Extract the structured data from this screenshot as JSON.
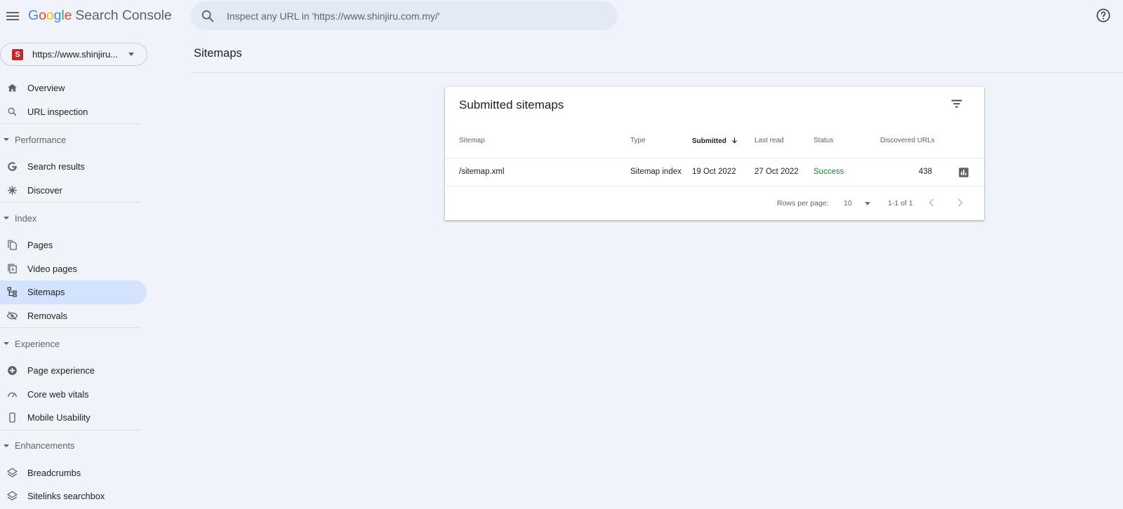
{
  "header": {
    "logo_letters": [
      {
        "ch": "G",
        "color": "#4285f4"
      },
      {
        "ch": "o",
        "color": "#ea4335"
      },
      {
        "ch": "o",
        "color": "#fbbc05"
      },
      {
        "ch": "g",
        "color": "#4285f4"
      },
      {
        "ch": "l",
        "color": "#34a853"
      },
      {
        "ch": "e",
        "color": "#ea4335"
      }
    ],
    "logo_product": "Search Console",
    "search_placeholder": "Inspect any URL in 'https://www.shinjiru.com.my/'",
    "icons": {
      "menu": "hamburger-menu-icon",
      "search": "search-icon",
      "help": "help-circle-icon"
    }
  },
  "property": {
    "label": "https://www.shinjiru...",
    "favicon_glyph": "S",
    "favicon_color": "#c62828"
  },
  "sidebar": {
    "items": [
      {
        "type": "item",
        "label": "Overview",
        "icon": "home-icon"
      },
      {
        "type": "item",
        "label": "URL inspection",
        "icon": "search-icon"
      },
      {
        "type": "divider"
      },
      {
        "type": "section",
        "label": "Performance"
      },
      {
        "type": "item",
        "label": "Search results",
        "icon": "google-g-icon"
      },
      {
        "type": "item",
        "label": "Discover",
        "icon": "asterisk-icon"
      },
      {
        "type": "divider"
      },
      {
        "type": "section",
        "label": "Index"
      },
      {
        "type": "item",
        "label": "Pages",
        "icon": "pages-copy-icon"
      },
      {
        "type": "item",
        "label": "Video pages",
        "icon": "video-pages-icon"
      },
      {
        "type": "item",
        "label": "Sitemaps",
        "icon": "sitemap-icon",
        "active": true
      },
      {
        "type": "item",
        "label": "Removals",
        "icon": "eye-off-icon"
      },
      {
        "type": "divider"
      },
      {
        "type": "section",
        "label": "Experience"
      },
      {
        "type": "item",
        "label": "Page experience",
        "icon": "plus-circle-icon"
      },
      {
        "type": "item",
        "label": "Core web vitals",
        "icon": "gauge-icon"
      },
      {
        "type": "item",
        "label": "Mobile Usability",
        "icon": "phone-icon"
      },
      {
        "type": "divider"
      },
      {
        "type": "section",
        "label": "Enhancements"
      },
      {
        "type": "item",
        "label": "Breadcrumbs",
        "icon": "layers-icon"
      },
      {
        "type": "item",
        "label": "Sitelinks searchbox",
        "icon": "layers-icon"
      }
    ]
  },
  "main": {
    "page_title": "Sitemaps",
    "card": {
      "title": "Submitted sitemaps",
      "columns": {
        "sitemap": "Sitemap",
        "type": "Type",
        "submitted": "Submitted",
        "last_read": "Last read",
        "status": "Status",
        "discovered": "Discovered URLs"
      },
      "rows": [
        {
          "sitemap": "/sitemap.xml",
          "type": "Sitemap index",
          "submitted": "19 Oct 2022",
          "last_read": "27 Oct 2022",
          "status": "Success",
          "discovered": "438"
        }
      ],
      "footer": {
        "rows_per_page_label": "Rows per page:",
        "rows_per_page_value": "10",
        "range": "1-1 of 1"
      },
      "status_color": "#188038"
    }
  },
  "colors": {
    "background": "#f0f4fa",
    "active_nav": "#d3e3fd",
    "search_bg": "#e2eaf6"
  }
}
